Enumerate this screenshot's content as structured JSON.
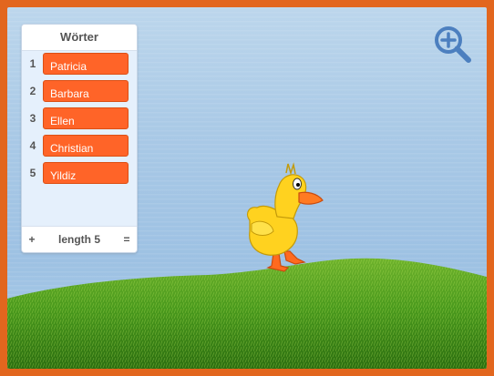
{
  "list": {
    "title": "Wörter",
    "items": [
      {
        "index": "1",
        "value": "Patricia"
      },
      {
        "index": "2",
        "value": "Barbara"
      },
      {
        "index": "3",
        "value": "Ellen"
      },
      {
        "index": "4",
        "value": "Christian"
      },
      {
        "index": "5",
        "value": "Yildiz"
      }
    ],
    "footer": {
      "add": "+",
      "length": "length 5",
      "resize": "="
    }
  },
  "controls": {
    "zoom_icon": "zoom-in-icon"
  },
  "sprite": {
    "name": "duck-icon"
  },
  "colors": {
    "frame": "#e2661e",
    "item": "#ff6428",
    "sky": "#a9c9e6",
    "grass": "#4e9a1e",
    "zoom": "#4c7fbf"
  }
}
